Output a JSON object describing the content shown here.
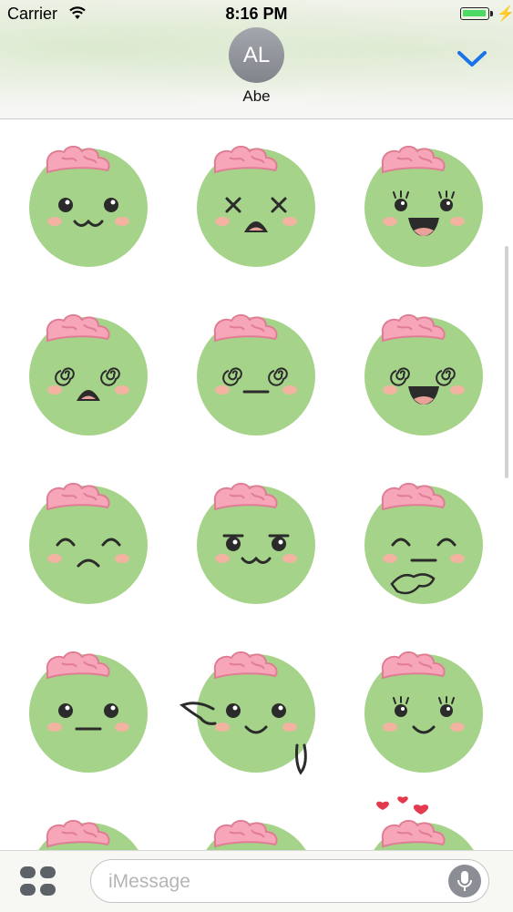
{
  "status_bar": {
    "carrier": "Carrier",
    "time": "8:16 PM",
    "battery_level": 1.0
  },
  "header": {
    "avatar_initials": "AL",
    "contact_name": "Abe",
    "collapse_icon": "chevron-down-icon"
  },
  "stickers": [
    {
      "name": "zombie-happy-cat-mouth",
      "eyes": "dots",
      "mouth": "cat"
    },
    {
      "name": "zombie-dead-eyes-frown",
      "eyes": "x",
      "mouth": "open-frown"
    },
    {
      "name": "zombie-laughing",
      "eyes": "lashes",
      "mouth": "open-smile"
    },
    {
      "name": "zombie-dizzy-shocked",
      "eyes": "spiral",
      "mouth": "open-frown"
    },
    {
      "name": "zombie-dizzy-neutral",
      "eyes": "spiral",
      "mouth": "flat"
    },
    {
      "name": "zombie-dizzy-laughing",
      "eyes": "spiral",
      "mouth": "open-smile"
    },
    {
      "name": "zombie-sad",
      "eyes": "closed",
      "mouth": "frown"
    },
    {
      "name": "zombie-smug-cat-mouth",
      "eyes": "smug",
      "mouth": "cat"
    },
    {
      "name": "zombie-thinking",
      "eyes": "closed",
      "mouth": "flat",
      "extra": "hand"
    },
    {
      "name": "zombie-neutral",
      "eyes": "dots",
      "mouth": "flat"
    },
    {
      "name": "zombie-waving",
      "eyes": "dots",
      "mouth": "smile",
      "extra": "wave"
    },
    {
      "name": "zombie-smiling-lashes",
      "eyes": "lashes",
      "mouth": "smile"
    },
    {
      "name": "zombie-partial-1",
      "eyes": "none",
      "mouth": "none"
    },
    {
      "name": "zombie-partial-2",
      "eyes": "none",
      "mouth": "none"
    },
    {
      "name": "zombie-partial-hearts",
      "eyes": "none",
      "mouth": "none",
      "extra": "hearts"
    }
  ],
  "input_bar": {
    "apps_icon": "app-drawer-icon",
    "placeholder": "iMessage",
    "mic_icon": "microphone-icon"
  },
  "colors": {
    "face": "#a6d38a",
    "brain": "#f7a6b9",
    "brain_outline": "#e07d95",
    "cheek": "#f2b3a0",
    "feature": "#2b2b2b",
    "accent": "#1a73e8"
  }
}
